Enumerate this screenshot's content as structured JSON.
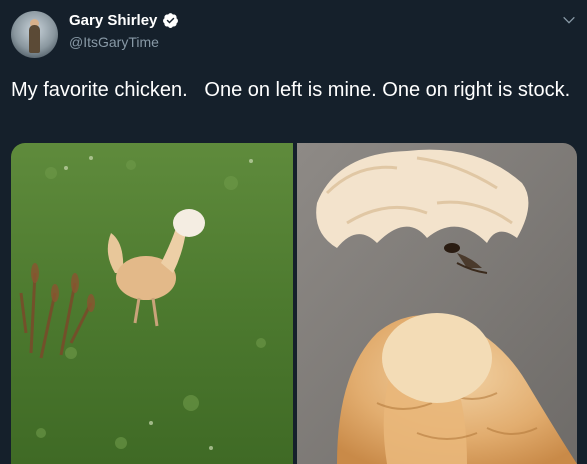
{
  "tweet": {
    "author": {
      "display_name": "Gary Shirley",
      "handle": "@ItsGaryTime",
      "verified": true
    },
    "text": "My favorite chicken.   One on left is mine. One on right is stock.",
    "media": [
      {
        "description_name": "chicken-photo-left"
      },
      {
        "description_name": "chicken-photo-right"
      }
    ]
  },
  "colors": {
    "background": "#15202b",
    "text": "#ffffff",
    "secondary_text": "#8899a6",
    "verified_badge": "#ffffff"
  },
  "icons": {
    "verified": "verified-badge-icon",
    "more": "chevron-down-icon"
  }
}
